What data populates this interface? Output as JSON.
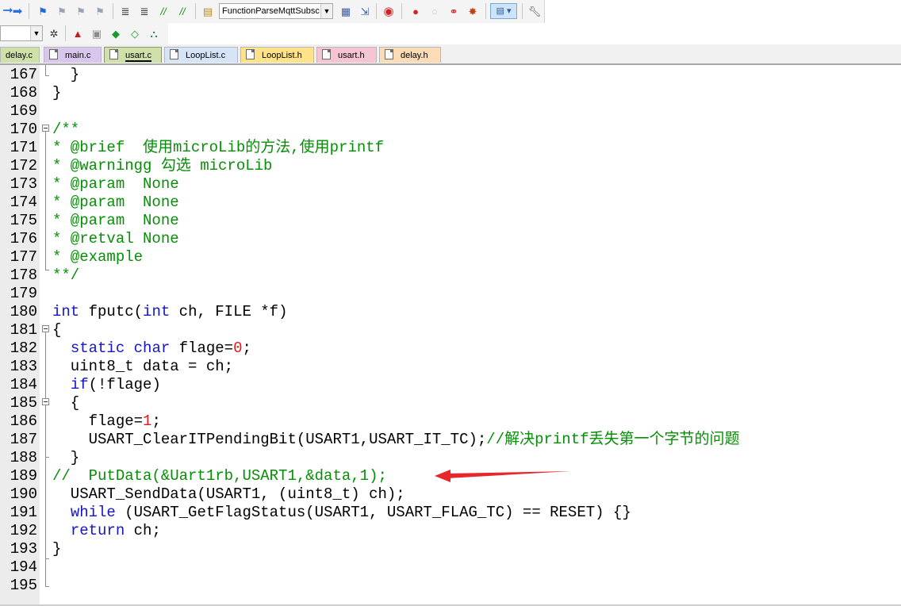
{
  "toolbar": {
    "function_combo_value": "FunctionParseMqttSubsc",
    "icons": [
      "arrow-back-icon",
      "arrow-forward-icon",
      "bookmark-set-icon",
      "bookmark-prev-icon",
      "bookmark-next-icon",
      "bookmark-clear-icon",
      "indent-icon",
      "unindent-icon",
      "comment-icon",
      "uncomment-icon",
      "open-file-icon",
      "find-in-files-icon",
      "incremental-find-icon",
      "debug-icon",
      "breakpoint-insert-icon",
      "breakpoint-enable-icon",
      "breakpoint-disable-icon",
      "breakpoint-kill-icon",
      "window-layout-icon",
      "config-icon"
    ],
    "build_icons": [
      "target-options-icon",
      "translate-icon",
      "build-icon",
      "rebuild-icon",
      "download-icon",
      "manage-icon"
    ]
  },
  "tabs": [
    {
      "label": "delay.c",
      "color": "#cfe0a8",
      "active": false,
      "show_icon": false
    },
    {
      "label": "main.c",
      "color": "#d9c6ec",
      "active": false,
      "show_icon": true
    },
    {
      "label": "usart.c",
      "color": "#cfe0a8",
      "active": true,
      "show_icon": true
    },
    {
      "label": "LoopList.c",
      "color": "#d6e4f8",
      "active": false,
      "show_icon": true
    },
    {
      "label": "LoopList.h",
      "color": "#ffe38a",
      "active": false,
      "show_icon": true
    },
    {
      "label": "usart.h",
      "color": "#f7c4d2",
      "active": false,
      "show_icon": true
    },
    {
      "label": "delay.h",
      "color": "#fbdcb7",
      "active": false,
      "show_icon": true
    }
  ],
  "lines": [
    {
      "n": "167",
      "segs": [
        {
          "t": "  }",
          "c": ""
        }
      ]
    },
    {
      "n": "168",
      "segs": [
        {
          "t": "}",
          "c": ""
        }
      ]
    },
    {
      "n": "169",
      "segs": []
    },
    {
      "n": "170",
      "segs": [
        {
          "t": "/**",
          "c": "cm"
        }
      ]
    },
    {
      "n": "171",
      "segs": [
        {
          "t": "* @brief  使用microLib的方法,使用printf",
          "c": "cm"
        }
      ]
    },
    {
      "n": "172",
      "segs": [
        {
          "t": "* @warningg 勾选 microLib",
          "c": "cm"
        }
      ]
    },
    {
      "n": "173",
      "segs": [
        {
          "t": "* @param  None",
          "c": "cm"
        }
      ]
    },
    {
      "n": "174",
      "segs": [
        {
          "t": "* @param  None",
          "c": "cm"
        }
      ]
    },
    {
      "n": "175",
      "segs": [
        {
          "t": "* @param  None",
          "c": "cm"
        }
      ]
    },
    {
      "n": "176",
      "segs": [
        {
          "t": "* @retval None",
          "c": "cm"
        }
      ]
    },
    {
      "n": "177",
      "segs": [
        {
          "t": "* @example",
          "c": "cm"
        }
      ]
    },
    {
      "n": "178",
      "segs": [
        {
          "t": "**/",
          "c": "cm"
        }
      ]
    },
    {
      "n": "179",
      "segs": []
    },
    {
      "n": "180",
      "segs": [
        {
          "t": "int",
          "c": "kw"
        },
        {
          "t": " fputc(",
          "c": ""
        },
        {
          "t": "int",
          "c": "kw"
        },
        {
          "t": " ch, FILE *f)",
          "c": ""
        }
      ]
    },
    {
      "n": "181",
      "segs": [
        {
          "t": "{",
          "c": ""
        }
      ]
    },
    {
      "n": "182",
      "segs": [
        {
          "t": "  ",
          "c": ""
        },
        {
          "t": "static",
          "c": "kw"
        },
        {
          "t": " ",
          "c": ""
        },
        {
          "t": "char",
          "c": "kw"
        },
        {
          "t": " flage=",
          "c": ""
        },
        {
          "t": "0",
          "c": "nm"
        },
        {
          "t": ";",
          "c": ""
        }
      ]
    },
    {
      "n": "183",
      "segs": [
        {
          "t": "  uint8_t data = ch;",
          "c": ""
        }
      ]
    },
    {
      "n": "184",
      "segs": [
        {
          "t": "  ",
          "c": ""
        },
        {
          "t": "if",
          "c": "kw"
        },
        {
          "t": "(!flage)",
          "c": ""
        }
      ]
    },
    {
      "n": "185",
      "segs": [
        {
          "t": "  {",
          "c": ""
        }
      ]
    },
    {
      "n": "186",
      "segs": [
        {
          "t": "    flage=",
          "c": ""
        },
        {
          "t": "1",
          "c": "nm"
        },
        {
          "t": ";",
          "c": ""
        }
      ]
    },
    {
      "n": "187",
      "segs": [
        {
          "t": "    USART_ClearITPendingBit(USART1,USART_IT_TC);",
          "c": ""
        },
        {
          "t": "//解决printf丢失第一个字节的问题",
          "c": "cm"
        }
      ]
    },
    {
      "n": "188",
      "segs": [
        {
          "t": "  }",
          "c": ""
        }
      ]
    },
    {
      "n": "189",
      "segs": [
        {
          "t": "//  PutData(&Uart1rb,USART1,&data,1);",
          "c": "cm"
        }
      ]
    },
    {
      "n": "190",
      "segs": [
        {
          "t": "  USART_SendData(USART1, (uint8_t) ch);",
          "c": ""
        }
      ]
    },
    {
      "n": "191",
      "segs": [
        {
          "t": "  ",
          "c": ""
        },
        {
          "t": "while",
          "c": "kw"
        },
        {
          "t": " (USART_GetFlagStatus(USART1, USART_FLAG_TC) == RESET) {}",
          "c": ""
        }
      ]
    },
    {
      "n": "192",
      "segs": [
        {
          "t": "  ",
          "c": ""
        },
        {
          "t": "return",
          "c": "kw"
        },
        {
          "t": " ch;",
          "c": ""
        }
      ]
    },
    {
      "n": "193",
      "segs": [
        {
          "t": "}",
          "c": ""
        }
      ]
    },
    {
      "n": "194",
      "segs": []
    },
    {
      "n": "195",
      "segs": []
    }
  ],
  "annotation": {
    "color": "#e8262b",
    "points_to_line": "189"
  }
}
